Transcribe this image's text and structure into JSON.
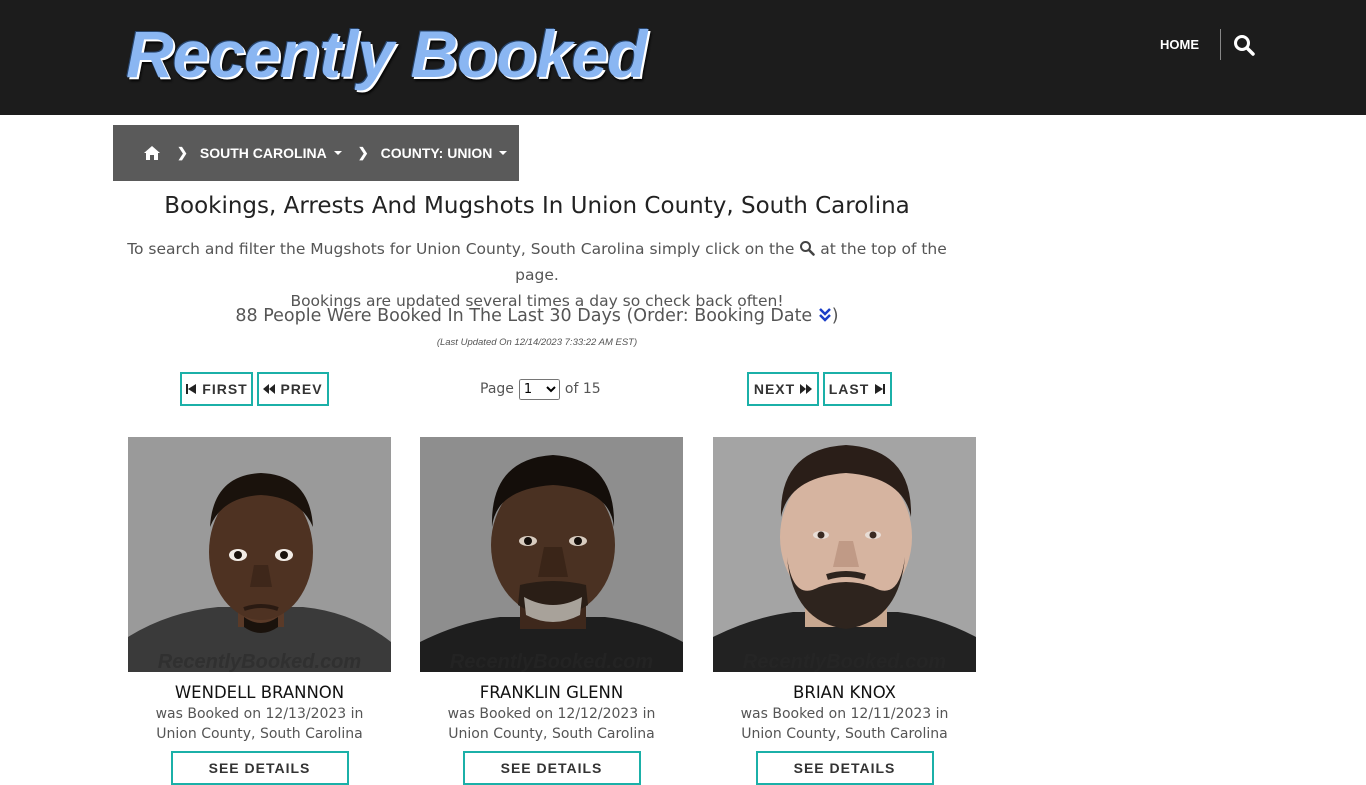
{
  "header": {
    "logo_text": "Recently Booked",
    "home_label": "HOME",
    "search_icon": "search-icon"
  },
  "breadcrumb": {
    "home_icon": "home-icon",
    "separator_icon": "chevron-right-icon",
    "state_label": "SOUTH CAROLINA",
    "county_label": "COUNTY: UNION"
  },
  "main": {
    "title": "Bookings, Arrests And Mugshots In Union County, South Carolina",
    "intro_before_icon": "To search and filter the Mugshots for Union County, South Carolina simply click on the",
    "intro_after_icon": "at the top of the page.",
    "intro_line2": "Bookings are updated several times a day so check back often!",
    "count_text": "88 People Were Booked In The Last 30 Days (Order: Booking Date",
    "count_close": ")",
    "order_icon": "double-chevron-down-icon",
    "last_updated": "(Last Updated On 12/14/2023 7:33:22 AM EST)"
  },
  "pager": {
    "first_label": "FIRST",
    "prev_label": "PREV",
    "next_label": "NEXT",
    "last_label": "LAST",
    "page_label": "Page",
    "current_page": "1",
    "of_label": "of 15"
  },
  "cards": [
    {
      "name": "WENDELL BRANNON",
      "booked_line": "was Booked on 12/13/2023 in",
      "location": "Union County, South Carolina",
      "button": "SEE DETAILS",
      "watermark": "RecentlyBooked.com"
    },
    {
      "name": "FRANKLIN GLENN",
      "booked_line": "was Booked on 12/12/2023 in",
      "location": "Union County, South Carolina",
      "button": "SEE DETAILS",
      "watermark": "RecentlyBooked.com"
    },
    {
      "name": "BRIAN KNOX",
      "booked_line": "was Booked on 12/11/2023 in",
      "location": "Union County, South Carolina",
      "button": "SEE DETAILS",
      "watermark": "RecentlyBooked.com"
    }
  ],
  "colors": {
    "header_bg": "#1c1c1c",
    "breadcrumb_bg": "#5a5a5a",
    "accent_teal": "#1bb0a8",
    "logo_blue": "#8ab6f2",
    "order_icon_blue": "#1a3ec8"
  }
}
